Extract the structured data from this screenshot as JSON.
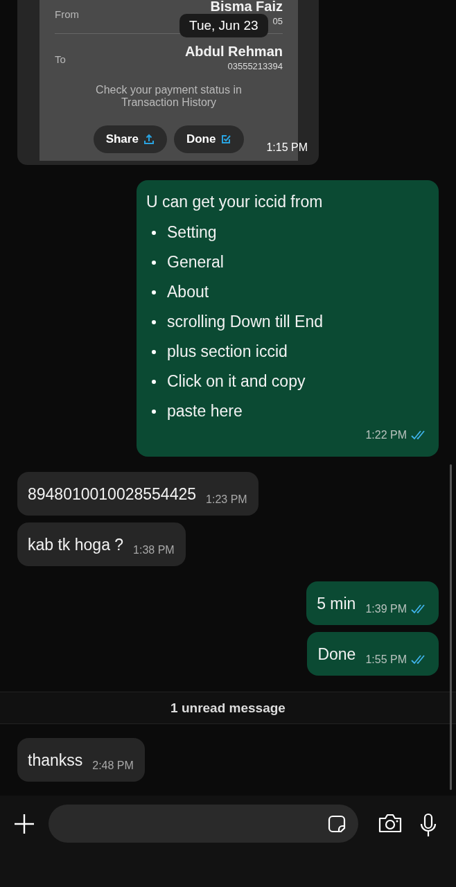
{
  "receipt": {
    "from_label": "From",
    "from_name": "Bisma Faiz",
    "from_number": "05",
    "to_label": "To",
    "to_name": "Abdul Rehman",
    "to_number": "03555213394",
    "note": "Check your payment status in Transaction History",
    "buttons": [
      {
        "label": "Share",
        "kind": "share"
      },
      {
        "label": "Done",
        "kind": "check"
      }
    ],
    "time": "1:15 PM"
  },
  "date_pill": "Tue, Jun 23",
  "messages": [
    {
      "kind": "outgoing",
      "text": "U can get your iccid from",
      "bullets": [
        "Setting",
        "General",
        "About",
        "scrolling Down till End",
        "plus section iccid",
        "Click on it and copy",
        "paste here"
      ],
      "time": "1:22 PM",
      "read": true
    },
    {
      "kind": "incoming",
      "text": "8948010010028554425",
      "time": "1:23 PM"
    },
    {
      "kind": "incoming",
      "text": "kab tk hoga ?",
      "time": "1:38 PM"
    },
    {
      "kind": "outgoing",
      "text": "5 min",
      "time": "1:39 PM",
      "read": true
    },
    {
      "kind": "outgoing",
      "text": "Done",
      "time": "1:55 PM",
      "read": true
    },
    {
      "kind": "divider",
      "text": "1 unread message"
    },
    {
      "kind": "incoming",
      "text": "thankss",
      "time": "2:48 PM"
    }
  ]
}
